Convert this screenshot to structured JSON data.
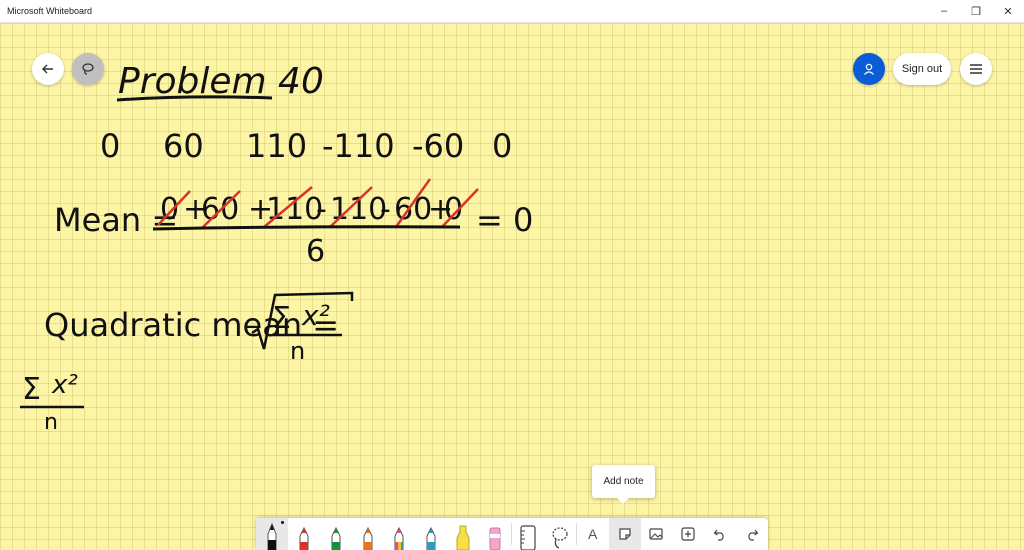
{
  "window": {
    "title": "Microsoft Whiteboard",
    "controls": {
      "minimize": "–",
      "maximize": "❐",
      "close": "✕"
    }
  },
  "header": {
    "sign_out_label": "Sign out"
  },
  "board": {
    "title": "Problem 40",
    "values": [
      "0",
      "60",
      "110",
      "-110",
      "-60",
      "0"
    ],
    "mean_label": "Mean =",
    "mean_numerator": [
      "0",
      "+",
      "60",
      "+",
      "110",
      "-",
      "110",
      "-",
      "60",
      "+",
      "0"
    ],
    "mean_denominator": "6",
    "mean_result": "= 0",
    "quadratic_label": "Quadratic mean =",
    "sum_symbol": "Σ",
    "x2": "x²",
    "n": "n",
    "ink_color": "#111111",
    "strike_color": "#d9342b"
  },
  "tooltip": {
    "label": "Add note"
  },
  "toolbar": {
    "pens": [
      {
        "name": "black-pen",
        "color": "#111111"
      },
      {
        "name": "red-pen",
        "color": "#d9342b"
      },
      {
        "name": "green-pen",
        "color": "#1a8f3c"
      },
      {
        "name": "orange-pen",
        "color": "#e8741f"
      },
      {
        "name": "rainbow-pen",
        "color": "#e84a8a"
      },
      {
        "name": "galaxy-pen",
        "color": "#2a9fb5"
      },
      {
        "name": "highlighter",
        "color": "#f5e04a"
      },
      {
        "name": "eraser",
        "color": "#f2a6c9"
      }
    ],
    "text_tool_label": "A"
  },
  "colors": {
    "accent_blue": "#0b5cd6",
    "canvas_yellow": "#fdf5a6"
  }
}
